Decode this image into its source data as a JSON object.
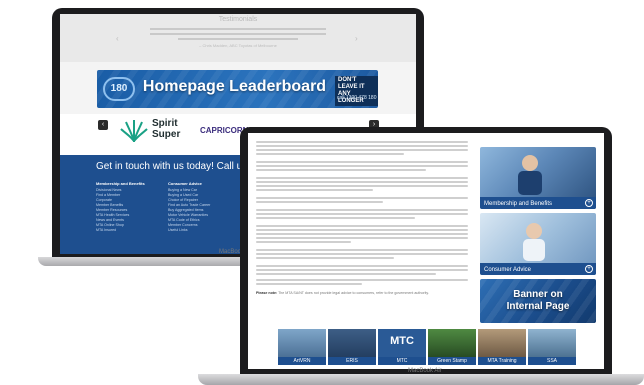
{
  "back_laptop": {
    "brand_label": "MacBook Air",
    "testimonial": {
      "title": "Testimonials",
      "author": "– Chris Madden, ABC Toyotas of Melbourne"
    },
    "leaderboard": {
      "logo": "180",
      "label": "Homepage Leaderboard",
      "ad_tag_line1": "DON'T LEAVE IT",
      "ad_tag_line2": "ANY LONGER",
      "ad_phone": "call 1300 478 180"
    },
    "slider": {
      "prev_icon": "‹",
      "next_icon": "›",
      "logo1": "Spirit Super",
      "logo1_line1": "Spirit",
      "logo1_line2": "Super",
      "logo2": "CAPRICORN"
    },
    "contact": {
      "heading": "Get in touch with us today! Call us on",
      "col1": {
        "title": "Membership and Benefits",
        "items": [
          "Divisional News",
          "Find a Member",
          "Corporate",
          "Member Benefits",
          "Member Resources",
          "MTA Health Services",
          "News and Events",
          "MTA Online Shop",
          "MTA Insured"
        ]
      },
      "col2": {
        "title": "Consumer Advice",
        "items": [
          "Buying a New Car",
          "Buying a Used Car",
          "Choice of Repairer",
          "Find an Auto Trade Career",
          "Buy Aggregated Items",
          "Motor Vehicle Warranties",
          "MTA Code of Ethics",
          "Member Concerns",
          "Useful Links"
        ]
      }
    }
  },
  "front_laptop": {
    "brand_label": "MacBook Air",
    "note_label": "Please note:",
    "note_text": "The MTA SA/NT does not provide legal advice to consumers, refer to the government authority.",
    "sidebar": [
      {
        "label": "Membership and Benefits",
        "icon": "plus"
      },
      {
        "label": "Consumer Advice",
        "icon": "plus"
      },
      {
        "label_line1": "Banner on",
        "label_line2": "Internal Page"
      }
    ],
    "tiles": [
      "ArtVRN",
      "ERIS",
      "MTC",
      "Green Stamp",
      "MTA Training",
      "SSA"
    ],
    "mtc_mark": "MTC"
  },
  "colors": {
    "mta_blue": "#1e4f8f",
    "leader_blue": "#2b73bd",
    "laptop_bezel": "#1c1c1e"
  }
}
